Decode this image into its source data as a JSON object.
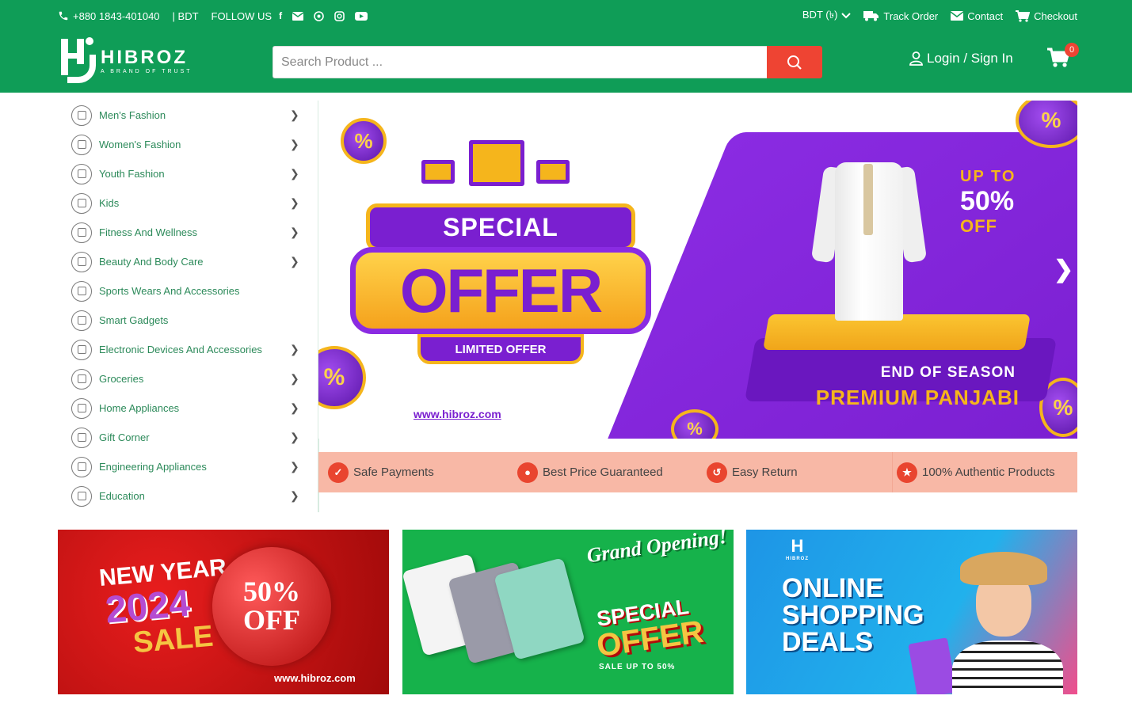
{
  "topbar": {
    "phone": "+880 1843-401040",
    "currency_short": "| BDT",
    "follow_label": "FOLLOW US",
    "currency_select": "BDT (৳)",
    "track_order": "Track Order",
    "contact": "Contact",
    "checkout": "Checkout"
  },
  "brand": {
    "name": "HIBROZ",
    "tagline": "A BRAND OF TRUST"
  },
  "search": {
    "placeholder": "Search Product ..."
  },
  "account": {
    "login_label": "Login / Sign In",
    "cart_count": "0"
  },
  "categories": [
    {
      "label": "Men's Fashion",
      "has_arrow": true
    },
    {
      "label": "Women's Fashion",
      "has_arrow": true
    },
    {
      "label": "Youth Fashion",
      "has_arrow": true
    },
    {
      "label": "Kids",
      "has_arrow": true
    },
    {
      "label": "Fitness And Wellness",
      "has_arrow": true
    },
    {
      "label": "Beauty And Body Care",
      "has_arrow": true
    },
    {
      "label": "Sports Wears And Accessories",
      "has_arrow": false
    },
    {
      "label": "Smart Gadgets",
      "has_arrow": false
    },
    {
      "label": "Electronic Devices And Accessories",
      "has_arrow": true
    },
    {
      "label": "Groceries",
      "has_arrow": true
    },
    {
      "label": "Home Appliances",
      "has_arrow": true
    },
    {
      "label": "Gift Corner",
      "has_arrow": true
    },
    {
      "label": "Engineering Appliances",
      "has_arrow": true
    },
    {
      "label": "Education",
      "has_arrow": true
    }
  ],
  "hero": {
    "special": "SPECIAL",
    "offer": "OFFER",
    "limited": "LIMITED OFFER",
    "url": "www.hibroz.com",
    "upto": "UP TO",
    "percent": "50%",
    "off": "OFF",
    "end_season": "END OF SEASON",
    "premium": "PREMIUM PANJABI"
  },
  "features": [
    {
      "label": "Safe Payments",
      "icon": "check-circle-icon"
    },
    {
      "label": "Best Price Guaranteed",
      "icon": "price-tag-icon"
    },
    {
      "label": "Easy Return",
      "icon": "return-icon"
    },
    {
      "label": "100% Authentic Products",
      "icon": "medal-icon"
    }
  ],
  "promos": {
    "p1": {
      "line1": "NEW YEAR",
      "year": "2024",
      "sale": "SALE",
      "off": "50% OFF",
      "url": "www.hibroz.com"
    },
    "p2": {
      "grand": "Grand Opening!",
      "special": "SPECIAL",
      "offer": "OFFER",
      "sub": "SALE UP TO 50%"
    },
    "p3": {
      "brand": "HIBROZ",
      "text": "ONLINE SHOPPING DEALS"
    }
  },
  "colors": {
    "primary_green": "#0f9d57",
    "accent_red": "#ee4433",
    "purple": "#8a2be2",
    "gold": "#f5b51c",
    "feature_bg": "#f8b8a6"
  }
}
